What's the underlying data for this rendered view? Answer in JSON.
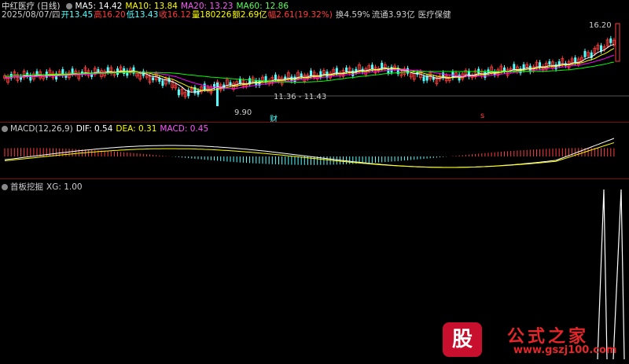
{
  "header": {
    "stock_name": "中红医疗 (日线)",
    "ma5": "MA5: 14.42",
    "ma10": "MA10: 13.84",
    "ma20": "MA20: 13.23",
    "ma60": "MA60: 12.86",
    "date": "2025/08/07/四",
    "open": "开13.45",
    "high": "高16.20",
    "low": "低13.43",
    "close": "收16.12",
    "volume": "量180226",
    "amount": "额2.69亿",
    "change": "幅2.61(19.32%)",
    "turnover": "换4.59%",
    "float": "流通3.93亿",
    "sector": "医疗保健"
  },
  "annotations": {
    "high_price": "16.20",
    "low_price": "9.90",
    "range": "11.36 - 11.43",
    "marker_cai": "财",
    "marker_s": "s"
  },
  "macd_panel": {
    "title": "MACD(12,26,9)",
    "dif": "DIF: 0.54",
    "dea": "DEA: 0.31",
    "macd": "MACD: 0.45"
  },
  "indicator_panel": {
    "title": "首板挖掘",
    "xg": "XG: 1.00"
  },
  "watermark": {
    "logo": "股",
    "name": "公式之家",
    "url": "www.gszj100.com"
  },
  "colors": {
    "up": "#ff3c3c",
    "down": "#54ffff",
    "ma5": "#ffffff",
    "ma10": "#ffff00",
    "ma20": "#ff00ff",
    "ma60": "#00ff00",
    "separator": "#7a0f0f"
  }
}
